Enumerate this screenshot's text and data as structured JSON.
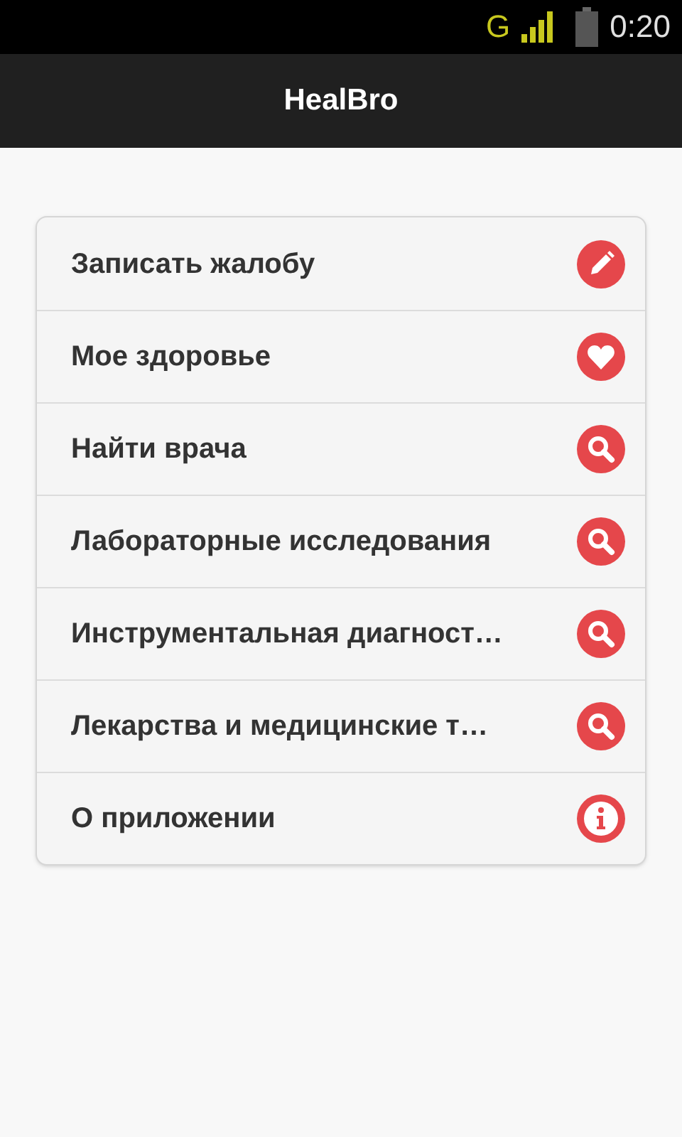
{
  "status_bar": {
    "network": "G",
    "time": "0:20"
  },
  "app_bar": {
    "title": "HealBro"
  },
  "menu": [
    {
      "label": "Записать жалобу",
      "kind": "write"
    },
    {
      "label": "Мое здоровье",
      "kind": "health"
    },
    {
      "label": "Найти врача",
      "kind": "find"
    },
    {
      "label": "Лабораторные исследования",
      "kind": "find"
    },
    {
      "label": "Инструментальная диагност…",
      "kind": "find"
    },
    {
      "label": "Лекарства и медицинские т…",
      "kind": "find"
    },
    {
      "label": "О приложении",
      "kind": "about"
    }
  ]
}
